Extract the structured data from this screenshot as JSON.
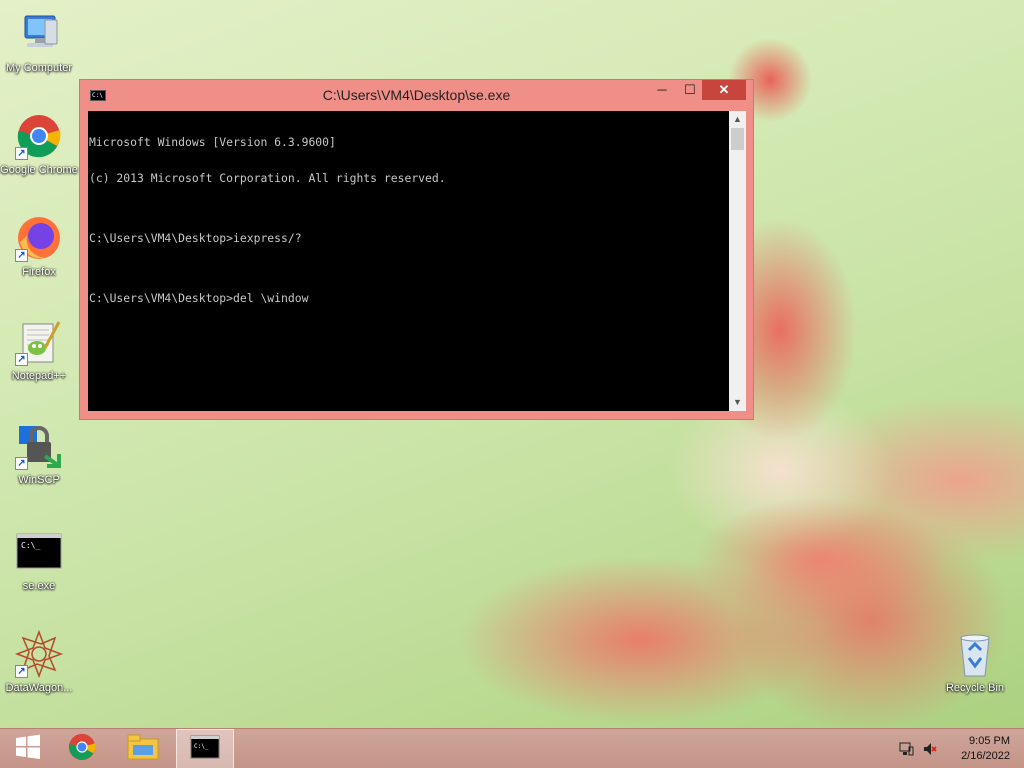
{
  "desktop": {
    "icons": [
      {
        "label": "My Computer",
        "icon": "computer-icon"
      },
      {
        "label": "Google Chrome",
        "icon": "chrome-icon"
      },
      {
        "label": "Firefox",
        "icon": "firefox-icon"
      },
      {
        "label": "Notepad++",
        "icon": "notepadpp-icon"
      },
      {
        "label": "WinSCP",
        "icon": "winscp-icon"
      },
      {
        "label": "se.exe",
        "icon": "console-app-icon"
      },
      {
        "label": "DataWagon...",
        "icon": "datawagon-icon"
      },
      {
        "label": "Recycle Bin",
        "icon": "recycle-bin-icon"
      }
    ]
  },
  "console": {
    "title": "C:\\Users\\VM4\\Desktop\\se.exe",
    "icon_text": "C:\\",
    "lines": [
      "Microsoft Windows [Version 6.3.9600]",
      "(c) 2013 Microsoft Corporation. All rights reserved.",
      "",
      "C:\\Users\\VM4\\Desktop>iexpress/?",
      "",
      "C:\\Users\\VM4\\Desktop>del \\window"
    ],
    "controls": {
      "minimize": "─",
      "maximize": "☐",
      "close": "✕"
    }
  },
  "taskbar": {
    "start_icon": "windows-start-icon",
    "pinned": [
      "chrome-icon",
      "file-explorer-icon",
      "console-app-icon"
    ],
    "active": "console-app-icon",
    "tray": [
      "network-icon",
      "volume-muted-icon"
    ],
    "clock": {
      "time": "9:05 PM",
      "date": "2/16/2022"
    }
  },
  "colors": {
    "window_frame": "#f08f88",
    "close_button": "#c7453c",
    "console_bg": "#000000",
    "console_fg": "#c8c8c8"
  }
}
